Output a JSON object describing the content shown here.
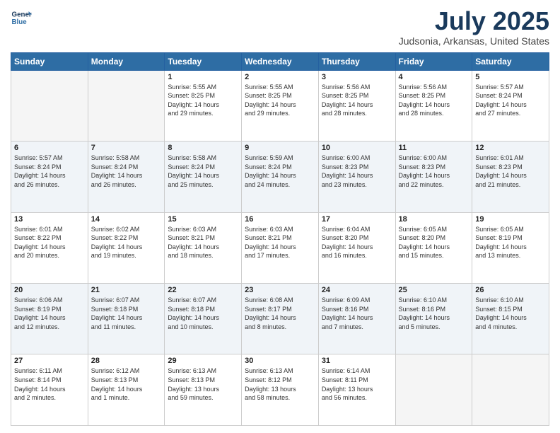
{
  "logo": {
    "line1": "General",
    "line2": "Blue"
  },
  "title": "July 2025",
  "subtitle": "Judsonia, Arkansas, United States",
  "days_of_week": [
    "Sunday",
    "Monday",
    "Tuesday",
    "Wednesday",
    "Thursday",
    "Friday",
    "Saturday"
  ],
  "weeks": [
    [
      {
        "day": "",
        "info": ""
      },
      {
        "day": "",
        "info": ""
      },
      {
        "day": "1",
        "info": "Sunrise: 5:55 AM\nSunset: 8:25 PM\nDaylight: 14 hours\nand 29 minutes."
      },
      {
        "day": "2",
        "info": "Sunrise: 5:55 AM\nSunset: 8:25 PM\nDaylight: 14 hours\nand 29 minutes."
      },
      {
        "day": "3",
        "info": "Sunrise: 5:56 AM\nSunset: 8:25 PM\nDaylight: 14 hours\nand 28 minutes."
      },
      {
        "day": "4",
        "info": "Sunrise: 5:56 AM\nSunset: 8:25 PM\nDaylight: 14 hours\nand 28 minutes."
      },
      {
        "day": "5",
        "info": "Sunrise: 5:57 AM\nSunset: 8:24 PM\nDaylight: 14 hours\nand 27 minutes."
      }
    ],
    [
      {
        "day": "6",
        "info": "Sunrise: 5:57 AM\nSunset: 8:24 PM\nDaylight: 14 hours\nand 26 minutes."
      },
      {
        "day": "7",
        "info": "Sunrise: 5:58 AM\nSunset: 8:24 PM\nDaylight: 14 hours\nand 26 minutes."
      },
      {
        "day": "8",
        "info": "Sunrise: 5:58 AM\nSunset: 8:24 PM\nDaylight: 14 hours\nand 25 minutes."
      },
      {
        "day": "9",
        "info": "Sunrise: 5:59 AM\nSunset: 8:24 PM\nDaylight: 14 hours\nand 24 minutes."
      },
      {
        "day": "10",
        "info": "Sunrise: 6:00 AM\nSunset: 8:23 PM\nDaylight: 14 hours\nand 23 minutes."
      },
      {
        "day": "11",
        "info": "Sunrise: 6:00 AM\nSunset: 8:23 PM\nDaylight: 14 hours\nand 22 minutes."
      },
      {
        "day": "12",
        "info": "Sunrise: 6:01 AM\nSunset: 8:23 PM\nDaylight: 14 hours\nand 21 minutes."
      }
    ],
    [
      {
        "day": "13",
        "info": "Sunrise: 6:01 AM\nSunset: 8:22 PM\nDaylight: 14 hours\nand 20 minutes."
      },
      {
        "day": "14",
        "info": "Sunrise: 6:02 AM\nSunset: 8:22 PM\nDaylight: 14 hours\nand 19 minutes."
      },
      {
        "day": "15",
        "info": "Sunrise: 6:03 AM\nSunset: 8:21 PM\nDaylight: 14 hours\nand 18 minutes."
      },
      {
        "day": "16",
        "info": "Sunrise: 6:03 AM\nSunset: 8:21 PM\nDaylight: 14 hours\nand 17 minutes."
      },
      {
        "day": "17",
        "info": "Sunrise: 6:04 AM\nSunset: 8:20 PM\nDaylight: 14 hours\nand 16 minutes."
      },
      {
        "day": "18",
        "info": "Sunrise: 6:05 AM\nSunset: 8:20 PM\nDaylight: 14 hours\nand 15 minutes."
      },
      {
        "day": "19",
        "info": "Sunrise: 6:05 AM\nSunset: 8:19 PM\nDaylight: 14 hours\nand 13 minutes."
      }
    ],
    [
      {
        "day": "20",
        "info": "Sunrise: 6:06 AM\nSunset: 8:19 PM\nDaylight: 14 hours\nand 12 minutes."
      },
      {
        "day": "21",
        "info": "Sunrise: 6:07 AM\nSunset: 8:18 PM\nDaylight: 14 hours\nand 11 minutes."
      },
      {
        "day": "22",
        "info": "Sunrise: 6:07 AM\nSunset: 8:18 PM\nDaylight: 14 hours\nand 10 minutes."
      },
      {
        "day": "23",
        "info": "Sunrise: 6:08 AM\nSunset: 8:17 PM\nDaylight: 14 hours\nand 8 minutes."
      },
      {
        "day": "24",
        "info": "Sunrise: 6:09 AM\nSunset: 8:16 PM\nDaylight: 14 hours\nand 7 minutes."
      },
      {
        "day": "25",
        "info": "Sunrise: 6:10 AM\nSunset: 8:16 PM\nDaylight: 14 hours\nand 5 minutes."
      },
      {
        "day": "26",
        "info": "Sunrise: 6:10 AM\nSunset: 8:15 PM\nDaylight: 14 hours\nand 4 minutes."
      }
    ],
    [
      {
        "day": "27",
        "info": "Sunrise: 6:11 AM\nSunset: 8:14 PM\nDaylight: 14 hours\nand 2 minutes."
      },
      {
        "day": "28",
        "info": "Sunrise: 6:12 AM\nSunset: 8:13 PM\nDaylight: 14 hours\nand 1 minute."
      },
      {
        "day": "29",
        "info": "Sunrise: 6:13 AM\nSunset: 8:13 PM\nDaylight: 13 hours\nand 59 minutes."
      },
      {
        "day": "30",
        "info": "Sunrise: 6:13 AM\nSunset: 8:12 PM\nDaylight: 13 hours\nand 58 minutes."
      },
      {
        "day": "31",
        "info": "Sunrise: 6:14 AM\nSunset: 8:11 PM\nDaylight: 13 hours\nand 56 minutes."
      },
      {
        "day": "",
        "info": ""
      },
      {
        "day": "",
        "info": ""
      }
    ]
  ]
}
